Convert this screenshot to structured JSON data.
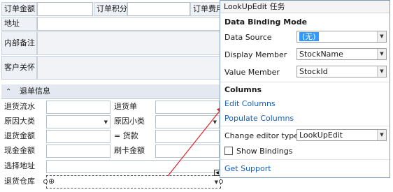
{
  "form": {
    "order_amount_label": "订单金额",
    "order_points_label": "订单积分",
    "order_fee_label": "订单费用",
    "address_label": "地址",
    "internal_note_label": "内部备注",
    "customer_care_label": "客户关怀"
  },
  "return_section": {
    "collapse_glyph": "⌃",
    "title": "退单信息",
    "rows": [
      {
        "left_label": "退货流水",
        "right_label": "退货单"
      },
      {
        "left_label": "原因大类",
        "right_label": "原因小类"
      },
      {
        "left_label": "退货金额",
        "right_label": "=  货款"
      },
      {
        "left_label": "现金金额",
        "right_label": "刷卡金额"
      },
      {
        "left_label": "选择地址",
        "right_label": ""
      },
      {
        "left_label": "退货仓库",
        "right_label": ""
      }
    ]
  },
  "smart_tag": {
    "title": "LookUpEdit 任务",
    "binding_header": "Data Binding Mode",
    "data_source_label": "Data Source",
    "data_source_value": "(无)",
    "display_member_label": "Display Member",
    "display_member_value": "StockName",
    "value_member_label": "Value Member",
    "value_member_value": "StockId",
    "columns_header": "Columns",
    "edit_columns_link": "Edit Columns",
    "populate_columns_link": "Populate Columns",
    "editor_type_label": "Change editor type",
    "editor_type_value": "LookUpEdit",
    "show_bindings_label": "Show Bindings",
    "show_bindings_checked": false,
    "get_support_link": "Get Support"
  },
  "colors": {
    "arrow": "#e02020",
    "link": "#1560bd",
    "selection": "#3399ff"
  }
}
